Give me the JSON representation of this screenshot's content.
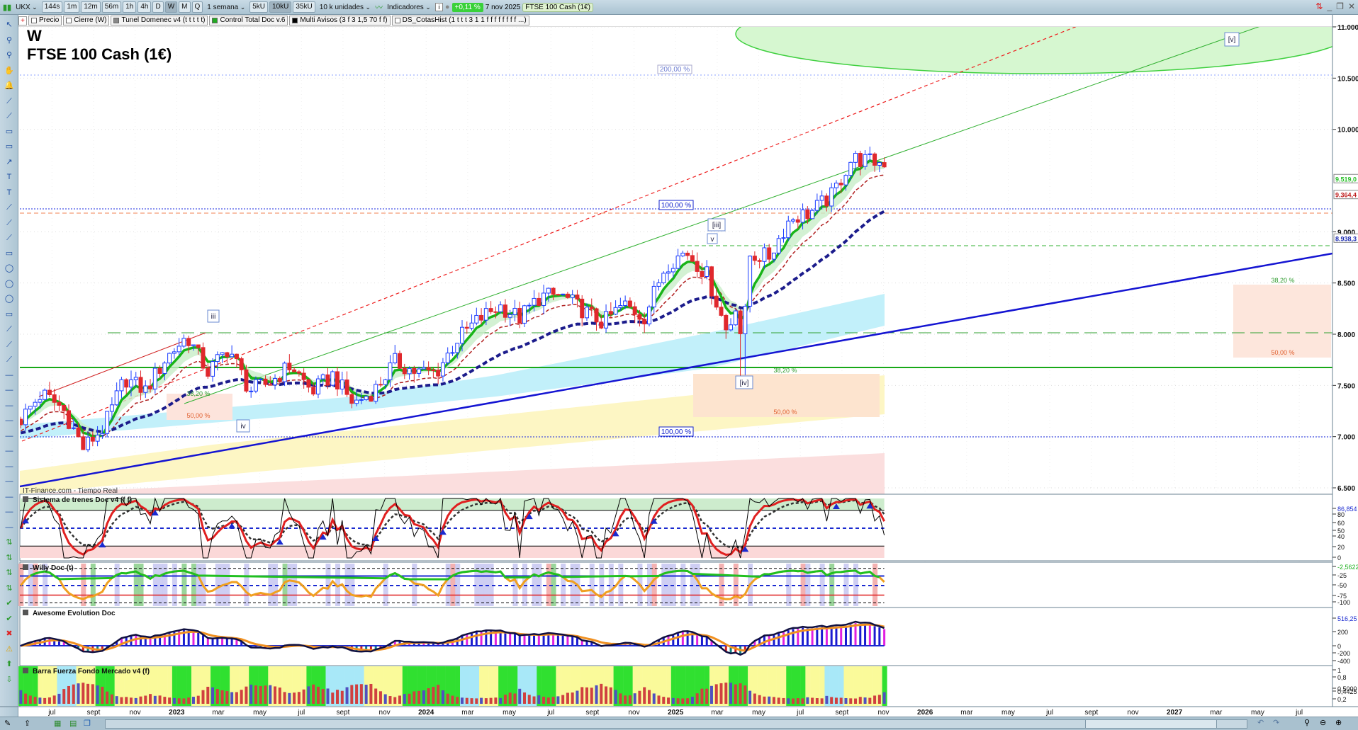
{
  "toolbar": {
    "symbol": "UKX",
    "timeframes": [
      "144s",
      "1m",
      "12m",
      "56m",
      "1h",
      "4h",
      "D",
      "W",
      "M",
      "Q"
    ],
    "active_timeframe": "W",
    "period": "1 semana",
    "units_buttons": [
      "5kU",
      "10kU",
      "35kU"
    ],
    "active_unit": "10kU",
    "units": "10 k unidades",
    "indicators": "Indicadores",
    "change": "+0,11 %",
    "date": "7 nov 2025",
    "instrument": "FTSE 100 Cash (1€)"
  },
  "legend": [
    "Precio",
    "Cierre (W)",
    "Tunel Domenec v4 (t t t t t)",
    "Control Total Doc v.6",
    "Multi Avisos (3 f 3 1,5 70 f f)",
    "DS_CotasHist (1 t t t 3 1 1 f f f f f f f f ...)"
  ],
  "chart": {
    "period_label": "W",
    "title": "FTSE 100 Cash (1€)",
    "watermark": "IT-Finance.com - Tiempo Real",
    "fib_labels": {
      "p200": "200,00 %",
      "p100a": "100,00 %",
      "p100b": "100,00 %",
      "f382a": "38,20 %",
      "f50a": "50,00 %",
      "f382b": "38,20 %",
      "f50b": "50,00 %",
      "f382c": "38,20 %",
      "f50c": "50,00 %"
    },
    "wave_labels": {
      "iii_small": "iii",
      "iv_small": "iv",
      "iii": "[iii]",
      "v_small": "v",
      "iv": "[iv]",
      "v": "[v]"
    },
    "price_ticks": [
      "11.000",
      "10.500",
      "10.000",
      "9.000",
      "8.500",
      "8.000",
      "7.500",
      "7.000",
      "6.500"
    ],
    "price_badges": {
      "green": "9.519,0",
      "red": "9.364,4",
      "blue": "8.938,3"
    }
  },
  "panels": {
    "sistema": {
      "label": "Sistema de trenes Doc v4 (f f)",
      "ticks": [
        "86,854",
        "80",
        "60",
        "50",
        "40",
        "20",
        "0"
      ]
    },
    "willy": {
      "label": "Willy Doc (t)",
      "ticks": [
        "-2,5622",
        "-25",
        "-50",
        "-75",
        "-100"
      ]
    },
    "awesome": {
      "label": "Awesome Evolution Doc",
      "ticks": [
        "516,25",
        "200",
        "0",
        "-200",
        "-400"
      ]
    },
    "barra": {
      "label": "Barra Fuerza Fondo Mercado v4 (f)",
      "ticks": [
        "1",
        "0,8",
        "0,5000",
        "0,4425",
        "0,2"
      ]
    }
  },
  "x_axis": [
    "jul",
    "sept",
    "nov",
    "2023",
    "mar",
    "may",
    "jul",
    "sept",
    "nov",
    "2024",
    "mar",
    "may",
    "jul",
    "sept",
    "nov",
    "2025",
    "mar",
    "may",
    "jul",
    "sept",
    "nov",
    "2026",
    "mar",
    "may",
    "jul",
    "sept",
    "nov",
    "2027",
    "mar",
    "may",
    "jul"
  ],
  "colors": {
    "up": "#1a3cff",
    "down": "#e0282d",
    "ma_fast": "#18b418",
    "ma_slow": "#1c1c8c",
    "trend": "#1414d2"
  },
  "chart_data": {
    "type": "candlestick",
    "timeframe": "weekly",
    "month_start": "2022-05",
    "monthly_close": [
      7600,
      7170,
      7420,
      7280,
      6890,
      7090,
      7570,
      7450,
      7770,
      7980,
      7630,
      7870,
      7450,
      7530,
      7700,
      7440,
      7600,
      7320,
      7450,
      7730,
      7630,
      7630,
      7950,
      8140,
      8280,
      8160,
      8370,
      8380,
      8240,
      8110,
      8290,
      8170,
      8670,
      8810,
      8580,
      8000,
      8770,
      8760,
      9130,
      9190,
      9350,
      9720,
      9680
    ],
    "ylim": [
      6500,
      11000
    ]
  }
}
